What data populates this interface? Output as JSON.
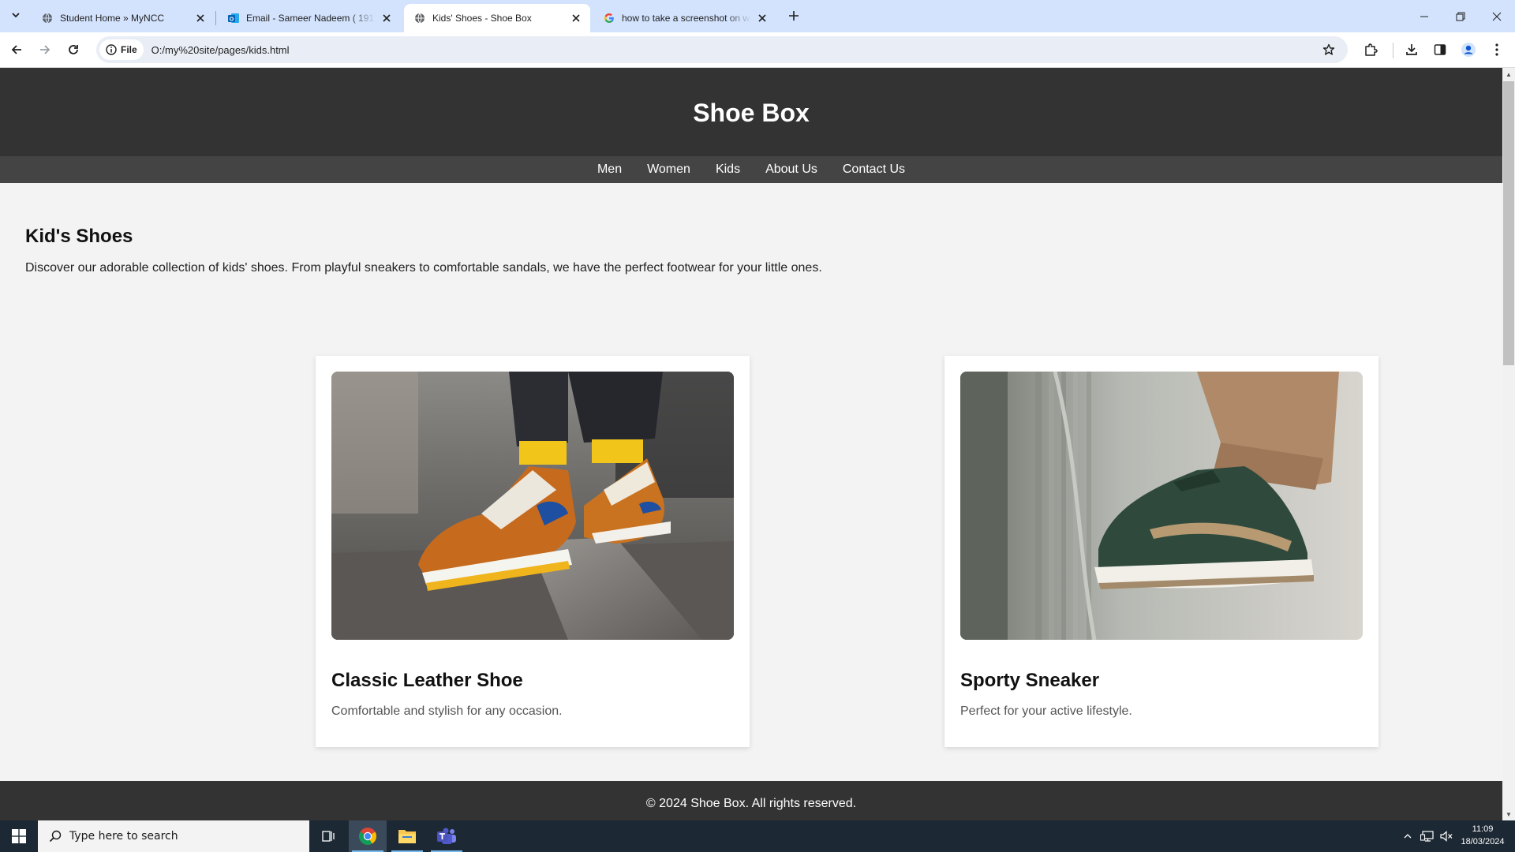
{
  "browser": {
    "tabs": [
      {
        "title": "Student Home » MyNCC",
        "icon": "globe-icon",
        "active": false
      },
      {
        "title": "Email - Sameer Nadeem ( 1917",
        "icon": "outlook-icon",
        "active": false
      },
      {
        "title": "Kids' Shoes - Shoe Box",
        "icon": "globe-icon",
        "active": true
      },
      {
        "title": "how to take a screenshot on wi",
        "icon": "google-icon",
        "active": false
      }
    ],
    "site_chip": "File",
    "url": "O:/my%20site/pages/kids.html"
  },
  "page": {
    "site_title": "Shoe Box",
    "nav": [
      "Men",
      "Women",
      "Kids",
      "About Us",
      "Contact Us"
    ],
    "heading": "Kid's Shoes",
    "intro": "Discover our adorable collection of kids' shoes. From playful sneakers to comfortable sandals, we have the perfect footwear for your little ones.",
    "products": [
      {
        "name": "Classic Leather Shoe",
        "description": "Comfortable and stylish for any occasion."
      },
      {
        "name": "Sporty Sneaker",
        "description": "Perfect for your active lifestyle."
      }
    ],
    "footer": "© 2024 Shoe Box. All rights reserved."
  },
  "taskbar": {
    "search_placeholder": "Type here to search",
    "time": "11:09",
    "date": "18/03/2024"
  },
  "colors": {
    "header_bg": "#333333",
    "nav_bg": "#444444",
    "tabstrip_bg": "#d3e3fd",
    "taskbar_bg": "#1c2833"
  }
}
